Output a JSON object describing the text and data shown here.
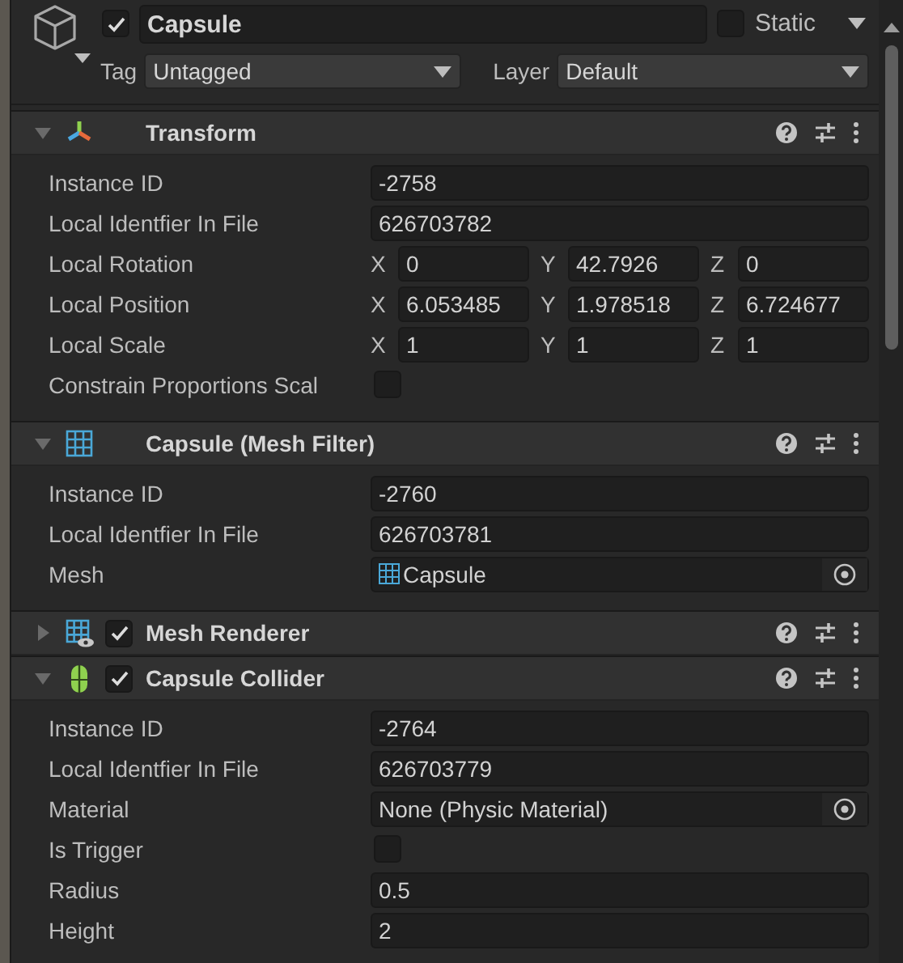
{
  "object": {
    "active": true,
    "name": "Capsule",
    "static": false,
    "static_label": "Static",
    "tag_label": "Tag",
    "tag": "Untagged",
    "layer_label": "Layer",
    "layer": "Default"
  },
  "components": [
    {
      "title": "Transform",
      "kind": "transform",
      "expanded": true,
      "fields": [
        {
          "kind": "text",
          "label": "Instance ID",
          "value": "-2758"
        },
        {
          "kind": "text",
          "label": "Local Identfier In File",
          "value": "626703782"
        },
        {
          "kind": "vector",
          "label": "Local Rotation",
          "axes": [
            {
              "axis": "X",
              "value": "0"
            },
            {
              "axis": "Y",
              "value": "42.7926"
            },
            {
              "axis": "Z",
              "value": "0"
            }
          ]
        },
        {
          "kind": "vector",
          "label": "Local Position",
          "axes": [
            {
              "axis": "X",
              "value": "6.053485"
            },
            {
              "axis": "Y",
              "value": "1.978518"
            },
            {
              "axis": "Z",
              "value": "6.724677"
            }
          ]
        },
        {
          "kind": "vector",
          "label": "Local Scale",
          "axes": [
            {
              "axis": "X",
              "value": "1"
            },
            {
              "axis": "Y",
              "value": "1"
            },
            {
              "axis": "Z",
              "value": "1"
            }
          ]
        },
        {
          "kind": "checkbox",
          "label": "Constrain Proportions Scal",
          "checked": false
        }
      ]
    },
    {
      "title": "Capsule (Mesh Filter)",
      "kind": "mesh-filter",
      "expanded": true,
      "fields": [
        {
          "kind": "text",
          "label": "Instance ID",
          "value": "-2760"
        },
        {
          "kind": "text",
          "label": "Local Identfier In File",
          "value": "626703781"
        },
        {
          "kind": "object",
          "label": "Mesh",
          "value": "Capsule",
          "asset_icon": true
        }
      ]
    },
    {
      "title": "Mesh Renderer",
      "kind": "mesh-renderer",
      "expanded": false,
      "enabled": true
    },
    {
      "title": "Capsule Collider",
      "kind": "capsule-collider",
      "expanded": true,
      "enabled": true,
      "fields": [
        {
          "kind": "text",
          "label": "Instance ID",
          "value": "-2764"
        },
        {
          "kind": "text",
          "label": "Local Identfier In File",
          "value": "626703779"
        },
        {
          "kind": "object",
          "label": "Material",
          "value": "None (Physic Material)",
          "asset_icon": false
        },
        {
          "kind": "checkbox",
          "label": "Is Trigger",
          "checked": false
        },
        {
          "kind": "text",
          "label": "Radius",
          "value": "0.5"
        },
        {
          "kind": "text",
          "label": "Height",
          "value": "2"
        }
      ]
    }
  ]
}
